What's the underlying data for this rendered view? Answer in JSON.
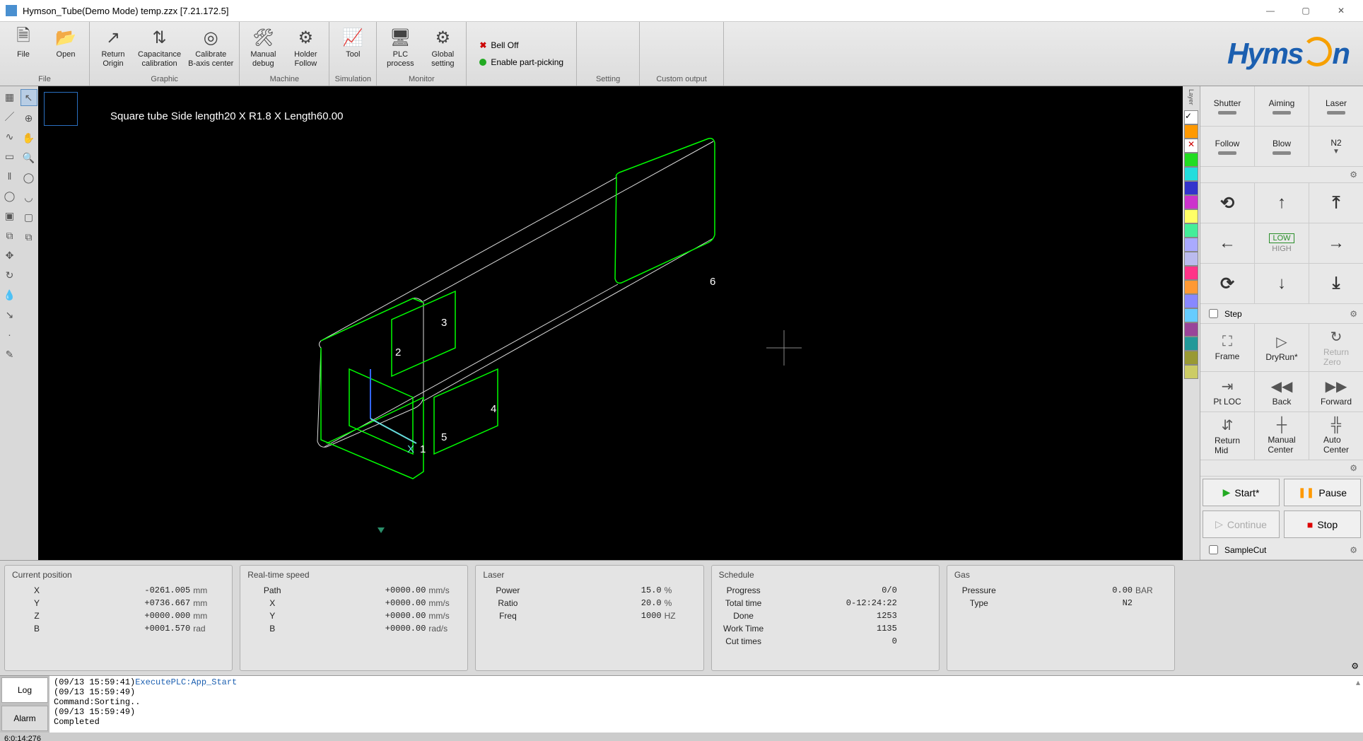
{
  "title": "Hymson_Tube(Demo Mode) temp.zzx  [7.21.172.5]",
  "ribbon": {
    "file": {
      "label": "File",
      "buttons": [
        {
          "id": "file",
          "label": "File"
        },
        {
          "id": "open",
          "label": "Open"
        }
      ]
    },
    "graphic": {
      "label": "Graphic",
      "buttons": [
        {
          "id": "ret-origin",
          "label": "Return\nOrigin"
        },
        {
          "id": "cap-cal",
          "label": "Capacitance\ncalibration"
        },
        {
          "id": "cal-b",
          "label": "Calibrate\nB-axis center"
        }
      ]
    },
    "machine": {
      "label": "Machine",
      "buttons": [
        {
          "id": "man-debug",
          "label": "Manual\ndebug"
        },
        {
          "id": "holder",
          "label": "Holder\nFollow"
        }
      ]
    },
    "simulation": {
      "label": "Simulation",
      "buttons": [
        {
          "id": "tool",
          "label": "Tool"
        }
      ]
    },
    "monitor": {
      "label": "Monitor",
      "buttons": [
        {
          "id": "plc",
          "label": "PLC\nprocess"
        },
        {
          "id": "global",
          "label": "Global\nsetting"
        }
      ]
    },
    "setting": {
      "label": "Setting",
      "bell_off": "Bell Off",
      "part_pick": "Enable part-picking"
    },
    "custom": {
      "label": "Custom output"
    }
  },
  "canvas": {
    "desc": "Square tube Side length20 X R1.8 X Length60.00",
    "markers": {
      "m1": "1",
      "m2": "2",
      "m3": "3",
      "m4": "4",
      "m5": "5",
      "m6": "6",
      "mx": "X"
    }
  },
  "layers": [
    {
      "c": "#ffffff",
      "chk": true
    },
    {
      "c": "#ff9900"
    },
    {
      "c": "#ffffff",
      "x": true
    },
    {
      "c": "#22dd22"
    },
    {
      "c": "#22dddd"
    },
    {
      "c": "#3333cc"
    },
    {
      "c": "#cc33cc"
    },
    {
      "c": "#ffff66"
    },
    {
      "c": "#44ee99"
    },
    {
      "c": "#aaaaff"
    },
    {
      "c": "#bbbbee"
    },
    {
      "c": "#ff3388"
    },
    {
      "c": "#ff9933"
    },
    {
      "c": "#8888ff"
    },
    {
      "c": "#66ccff"
    },
    {
      "c": "#994499"
    },
    {
      "c": "#229999"
    },
    {
      "c": "#999933"
    },
    {
      "c": "#cccc66"
    }
  ],
  "right": {
    "row1": [
      {
        "id": "shutter",
        "label": "Shutter"
      },
      {
        "id": "aiming",
        "label": "Aiming"
      },
      {
        "id": "laser",
        "label": "Laser"
      }
    ],
    "row2": [
      {
        "id": "follow",
        "label": "Follow"
      },
      {
        "id": "blow",
        "label": "Blow"
      },
      {
        "id": "n2",
        "label": "N2"
      }
    ],
    "lowhigh": {
      "low": "LOW",
      "high": "HIGH"
    },
    "step": "Step",
    "row5": [
      {
        "id": "frame",
        "label": "Frame",
        "icon": "⛶"
      },
      {
        "id": "dryrun",
        "label": "DryRun*",
        "icon": "▷"
      },
      {
        "id": "retzero",
        "label": "Return\nZero",
        "icon": "↻",
        "disabled": true
      }
    ],
    "row6": [
      {
        "id": "ptloc",
        "label": "Pt LOC",
        "icon": "⇥"
      },
      {
        "id": "back",
        "label": "Back",
        "icon": "◀◀"
      },
      {
        "id": "forward",
        "label": "Forward",
        "icon": "▶▶"
      }
    ],
    "row7": [
      {
        "id": "retmid",
        "label": "Return\nMid",
        "icon": "⇵"
      },
      {
        "id": "mancenter",
        "label": "Manual\nCenter",
        "icon": "┼"
      },
      {
        "id": "autocenter",
        "label": "Auto\nCenter",
        "icon": "╬"
      }
    ],
    "start": "Start*",
    "pause": "Pause",
    "continue": "Continue",
    "stop": "Stop",
    "samplecut": "SampleCut"
  },
  "status": {
    "curpos": {
      "title": "Current position",
      "rows": [
        {
          "k": "X",
          "v": "-0261.005",
          "u": "mm"
        },
        {
          "k": "Y",
          "v": "+0736.667",
          "u": "mm"
        },
        {
          "k": "Z",
          "v": "+0000.000",
          "u": "mm"
        },
        {
          "k": "B",
          "v": "+0001.570",
          "u": "rad"
        }
      ]
    },
    "speed": {
      "title": "Real-time speed",
      "rows": [
        {
          "k": "Path",
          "v": "+0000.00",
          "u": "mm/s"
        },
        {
          "k": "X",
          "v": "+0000.00",
          "u": "mm/s"
        },
        {
          "k": "Y",
          "v": "+0000.00",
          "u": "mm/s"
        },
        {
          "k": "B",
          "v": "+0000.00",
          "u": "rad/s"
        }
      ]
    },
    "laser": {
      "title": "Laser",
      "rows": [
        {
          "k": "Power",
          "v": "15.0",
          "u": "%"
        },
        {
          "k": "Ratio",
          "v": "20.0",
          "u": "%"
        },
        {
          "k": "Freq",
          "v": "1000",
          "u": "HZ"
        }
      ]
    },
    "sched": {
      "title": "Schedule",
      "rows": [
        {
          "k": "Progress",
          "v": "0/0",
          "u": ""
        },
        {
          "k": "Total time",
          "v": "0-12:24:22",
          "u": ""
        },
        {
          "k": "Done",
          "v": "1253",
          "u": ""
        },
        {
          "k": "Work Time",
          "v": "1135",
          "u": ""
        },
        {
          "k": "Cut times",
          "v": "0",
          "u": ""
        }
      ]
    },
    "gas": {
      "title": "Gas",
      "rows": [
        {
          "k": "Pressure",
          "v": "0.00",
          "u": "BAR"
        },
        {
          "k": "Type",
          "v": "N2",
          "u": ""
        }
      ]
    }
  },
  "log": {
    "tabs": {
      "log": "Log",
      "alarm": "Alarm"
    },
    "lines": [
      "(09/13 15:59:41)ExecutePLC:App_Start",
      "(09/13 15:59:49)",
      "Command:Sorting..",
      "(09/13 15:59:49)",
      "Completed"
    ]
  },
  "footer": "6:0:14:276"
}
